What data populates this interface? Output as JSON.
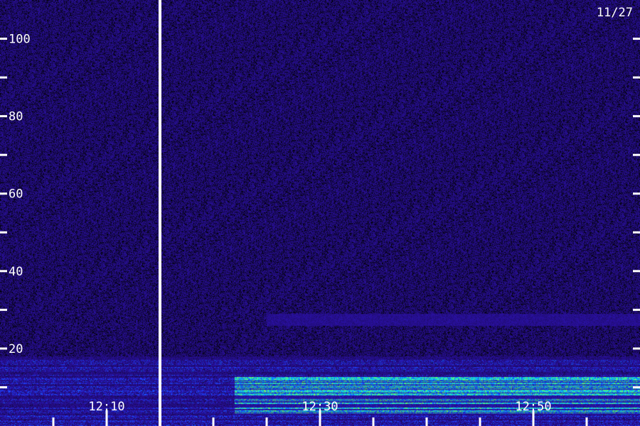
{
  "chart_data": {
    "type": "heatmap",
    "date_label": "11/27",
    "y_axis": {
      "ylim": [
        0,
        110
      ],
      "major_ticks": [
        {
          "value": 20,
          "label": "20"
        },
        {
          "value": 40,
          "label": "40"
        },
        {
          "value": 60,
          "label": "60"
        },
        {
          "value": 80,
          "label": "80"
        },
        {
          "value": 100,
          "label": "100"
        }
      ],
      "minor_ticks": [
        10,
        30,
        50,
        70,
        90
      ]
    },
    "x_axis": {
      "xlim": [
        "12:00",
        "13:00"
      ],
      "major_ticks": [
        {
          "value": "12:10",
          "label": "12:10"
        },
        {
          "value": "12:30",
          "label": "12:30"
        },
        {
          "value": "12:50",
          "label": "12:50"
        }
      ],
      "minor_ticks": [
        "12:05",
        "12:15",
        "12:20",
        "12:25",
        "12:35",
        "12:40",
        "12:45",
        "12:55"
      ]
    },
    "marker_time": "12:15",
    "colormap": [
      "#000000",
      "#1a0a5c",
      "#2a10a0",
      "#1e3cff",
      "#00c8ff",
      "#40ff80",
      "#ffff00"
    ],
    "features": [
      {
        "name": "low-band noise",
        "y_range": [
          0,
          18
        ],
        "x_range": [
          "12:00",
          "13:00"
        ],
        "intensity": 0.55
      },
      {
        "name": "strong bands",
        "y_range": [
          3,
          13
        ],
        "x_range": [
          "12:22",
          "13:00"
        ],
        "intensity": 0.9
      },
      {
        "name": "faint band",
        "y_range": [
          26,
          29
        ],
        "x_range": [
          "12:25",
          "13:00"
        ],
        "intensity": 0.35
      }
    ]
  }
}
